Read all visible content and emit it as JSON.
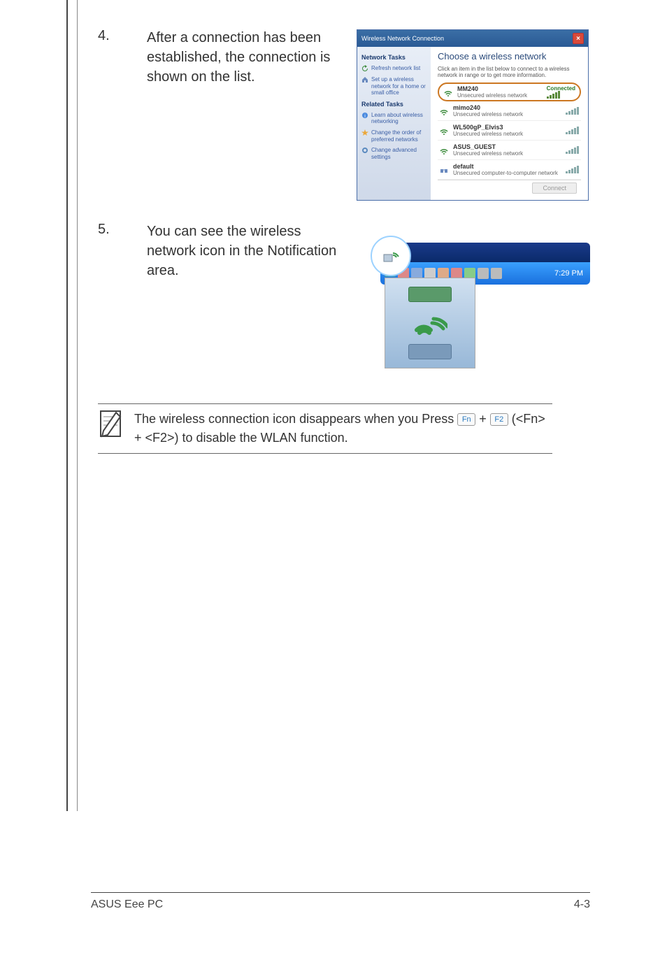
{
  "steps": {
    "s4": {
      "num": "4.",
      "text": "After a connection has been established, the connection is shown on the list."
    },
    "s5": {
      "num": "5.",
      "text": "You can see the wireless network icon in the Notification area."
    }
  },
  "dialog": {
    "title": "Wireless Network Connection",
    "side": {
      "head1": "Network Tasks",
      "links1": [
        {
          "label": "Refresh network list"
        },
        {
          "label": "Set up a wireless network for a home or small office"
        }
      ],
      "head2": "Related Tasks",
      "links2": [
        {
          "label": "Learn about wireless networking"
        },
        {
          "label": "Change the order of preferred networks"
        },
        {
          "label": "Change advanced settings"
        }
      ]
    },
    "main": {
      "head": "Choose a wireless network",
      "sub": "Click an item in the list below to connect to a wireless network in range or to get more information.",
      "networks": [
        {
          "name": "MM240",
          "sec": "Unsecured wireless network",
          "status": "Connected",
          "sel": true
        },
        {
          "name": "mimo240",
          "sec": "Unsecured wireless network",
          "status": "",
          "sel": false
        },
        {
          "name": "WL500gP_Elvis3",
          "sec": "Unsecured wireless network",
          "status": "",
          "sel": false
        },
        {
          "name": "ASUS_GUEST",
          "sec": "Unsecured wireless network",
          "status": "",
          "sel": false
        },
        {
          "name": "default",
          "sec": "Unsecured computer-to-computer network",
          "status": "",
          "sel": false
        }
      ],
      "connect_btn": "Connect"
    }
  },
  "tray": {
    "time": "7:29 PM"
  },
  "note": {
    "pre": "The wireless connection icon disappears when you Press ",
    "key1": "Fn",
    "plus": " + ",
    "key2": "F2",
    "post": " (<Fn> + <F2>) to disable the WLAN function."
  },
  "footer": {
    "left": "ASUS Eee PC",
    "right": "4-3"
  }
}
